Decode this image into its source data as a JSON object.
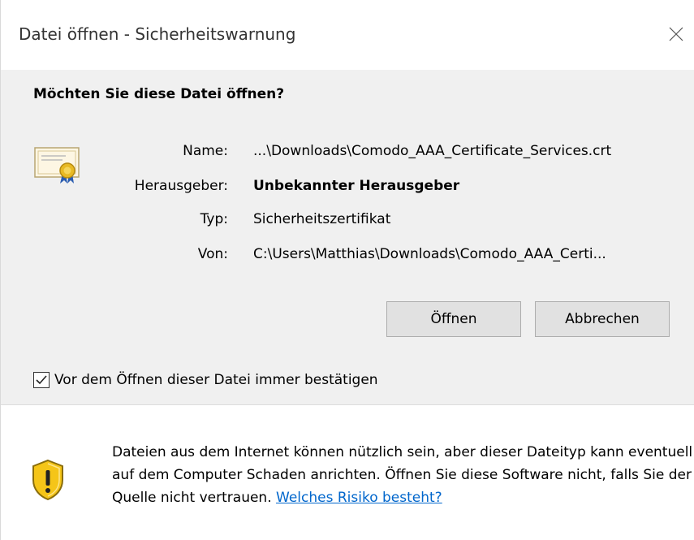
{
  "window": {
    "title": "Datei öffnen - Sicherheitswarnung",
    "close_icon": "close-icon"
  },
  "dialog": {
    "heading": "Möchten Sie diese Datei öffnen?",
    "icon": "certificate-icon",
    "fields": {
      "name_label": "Name:",
      "name_value": "...\\Downloads\\Comodo_AAA_Certificate_Services.crt",
      "publisher_label": "Herausgeber:",
      "publisher_value": "Unbekannter Herausgeber",
      "type_label": "Typ:",
      "type_value": "Sicherheitszertifikat",
      "from_label": "Von:",
      "from_value": "C:\\Users\\Matthias\\Downloads\\Comodo_AAA_Certi..."
    },
    "buttons": {
      "open": "Öffnen",
      "cancel": "Abbrechen"
    },
    "checkbox": {
      "label": "Vor dem Öffnen dieser Datei immer bestätigen",
      "checked": true
    }
  },
  "footer": {
    "icon": "shield-warning-icon",
    "warning_text": "Dateien aus dem Internet können nützlich sein, aber dieser Dateityp kann eventuell auf dem Computer Schaden anrichten. Öffnen Sie diese Software nicht, falls Sie der Quelle nicht vertrauen.",
    "link_text": "Welches Risiko besteht?"
  },
  "colors": {
    "link": "#0066cc",
    "button_bg": "#e1e1e1",
    "dialog_bg": "#f0f0f0",
    "shield_yellow": "#f5c518"
  }
}
